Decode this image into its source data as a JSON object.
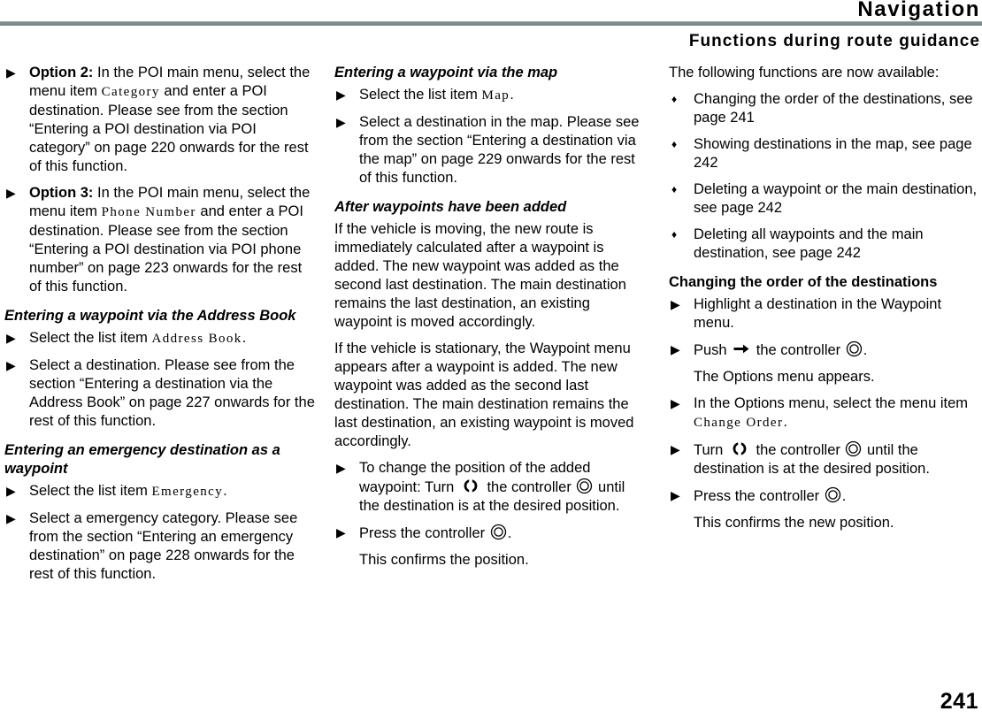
{
  "header": {
    "chapter_title": "Navigation",
    "section_title": "Functions during route guidance",
    "rule_color": "#7d8e8e"
  },
  "page_number": "241",
  "icons": {
    "step_marker": "▶",
    "bullet_marker": "♦",
    "controller": "controller-icon",
    "turn": "turn-controller-icon",
    "push_right": "push-right-arrow-icon"
  },
  "column_1": {
    "option2": {
      "lead": "Option 2:",
      "text_a": " In the POI main menu, select the menu item ",
      "menu_item": "Category",
      "text_b": " and enter a POI destination. Please see from the section “Entering a POI destination via POI category” on page 220 onwards for the rest of this function."
    },
    "option3": {
      "lead": "Option 3:",
      "text_a": " In the POI main menu, select the menu item ",
      "menu_item": "Phone Number",
      "text_b": " and enter a POI destination. Please see from the section “Entering a POI destination via POI phone number” on page 223 onwards for the rest of this function."
    },
    "heading_address_book": "Entering a waypoint via the Address Book",
    "step_select_address_book": {
      "text_a": "Select the list item ",
      "menu_item": "Address Book",
      "text_b": "."
    },
    "step_select_destination": "Select a destination. Please see from the section “Entering a destination via the Address Book” on page 227 onwards for the rest of this function.",
    "heading_emergency": "Entering an emergency destination as a waypoint",
    "step_select_emergency": {
      "text_a": "Select the list item ",
      "menu_item": "Emergency",
      "text_b": "."
    },
    "step_select_emergency_category": "Select a emergency category. Please see from the section “Entering an emergency destination” on page 228 onwards for the rest of this function."
  },
  "column_2": {
    "heading_via_map": "Entering a waypoint via the map",
    "step_select_map": {
      "text_a": "Select the list item ",
      "menu_item": "Map",
      "text_b": "."
    },
    "step_select_destination_map": "Select a destination in the map. Please see from the section “Entering a destination via the map” on page 229 onwards for the rest of this function.",
    "heading_after_waypoints": "After waypoints have been added",
    "para_moving": "If the vehicle is moving, the new route is immediately calculated after a waypoint is added. The new waypoint was added as the second last destination. The main destination remains the last destination, an existing waypoint is moved accordingly.",
    "para_stationary": "If the vehicle is stationary, the Waypoint menu appears after a waypoint is added. The new waypoint was added as the second last destination. The main destination remains the last destination, an existing waypoint is moved accordingly.",
    "step_change_position": {
      "text_a": "To change the position of the added waypoint: Turn ",
      "text_b": " the controller ",
      "text_c": " until the destination is at the desired position."
    },
    "step_press_controller": {
      "text_a": "Press the controller ",
      "text_b": "."
    },
    "note_confirms_position": "This confirms the position."
  },
  "column_3": {
    "intro": "The following functions are now available:",
    "bullets": [
      "Changing the order of the destinations, see page 241",
      "Showing destinations in the map, see page 242",
      "Deleting a waypoint or the main destination, see page 242",
      "Deleting all waypoints and the main destination, see page 242"
    ],
    "heading_changing_order": "Changing the order of the destinations",
    "step_highlight": "Highlight a destination in the Waypoint menu.",
    "step_push": {
      "text_a": "Push ",
      "text_b": " the controller ",
      "text_c": "."
    },
    "note_options_menu": "The Options menu appears.",
    "step_select_change_order": {
      "text_a": "In the Options menu, select the menu item ",
      "menu_item": "Change Order",
      "text_b": "."
    },
    "step_turn": {
      "text_a": "Turn ",
      "text_b": " the controller ",
      "text_c": " until the destination is at the desired position."
    },
    "step_press_controller": {
      "text_a": "Press the controller ",
      "text_b": "."
    },
    "note_confirms_new_position": "This confirms the new position."
  }
}
